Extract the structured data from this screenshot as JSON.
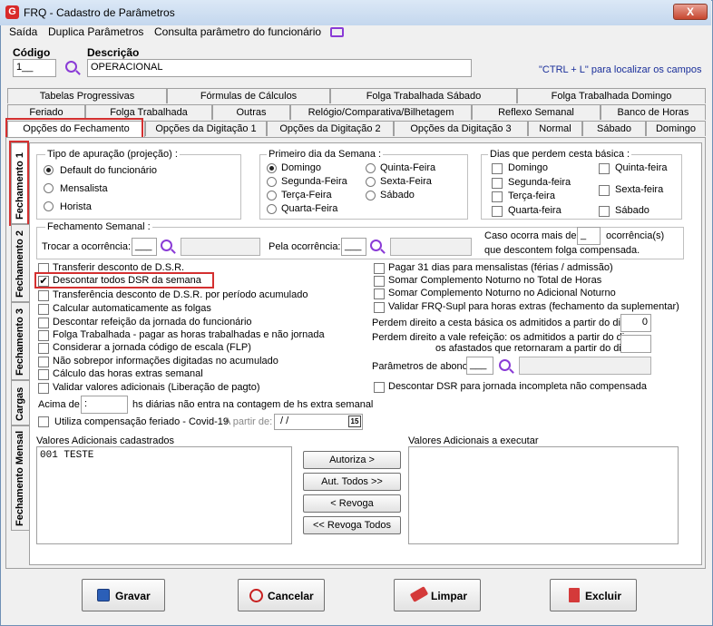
{
  "window": {
    "title": "FRQ - Cadastro de Parâmetros",
    "close": "X"
  },
  "menu": [
    "Saída",
    "Duplica Parâmetros",
    "Consulta parâmetro do funcionário"
  ],
  "header": {
    "codigo_label": "Código",
    "codigo_value": "1__",
    "descricao_label": "Descrição",
    "descricao_value": "OPERACIONAL",
    "hint": "\"CTRL + L\" para localizar os campos"
  },
  "tabs_row1": [
    "Tabelas Progressivas",
    "Fórmulas de Cálculos",
    "Folga Trabalhada Sábado",
    "Folga Trabalhada Domingo"
  ],
  "tabs_row2": [
    "Feriado",
    "Folga Trabalhada",
    "Outras",
    "Relógio/Comparativa/Bilhetagem",
    "Reflexo Semanal",
    "Banco de Horas"
  ],
  "tabs_row3": [
    "Opções do Fechamento",
    "Opções da Digitação 1",
    "Opções da Digitação 2",
    "Opções da Digitação 3",
    "Normal",
    "Sábado",
    "Domingo"
  ],
  "vtabs": [
    "Fechamento 1",
    "Fechamento 2",
    "Fechamento 3",
    "Cargas",
    "Fechamento Mensal"
  ],
  "tipo": {
    "title": "Tipo de apuração (projeção) :",
    "options": [
      "Default do funcionário",
      "Mensalista",
      "Horista"
    ]
  },
  "primeiro": {
    "title": "Primeiro dia da Semana :",
    "col1": [
      "Domingo",
      "Segunda-Feira",
      "Terça-Feira",
      "Quarta-Feira"
    ],
    "col2": [
      "Quinta-Feira",
      "Sexta-Feira",
      "Sábado"
    ]
  },
  "dias": {
    "title": "Dias que perdem cesta básica :",
    "col1": [
      "Domingo",
      "Segunda-feira",
      "Terça-feira",
      "Quarta-feira"
    ],
    "col2": [
      "Quinta-feira",
      "Sexta-feira",
      "Sábado"
    ]
  },
  "fech_sem": {
    "title": "Fechamento Semanal :",
    "trocar": "Trocar a ocorrência:",
    "trocar_val": "___",
    "pela": "Pela ocorrência:",
    "pela_val": "___",
    "caso1": "Caso ocorra mais de",
    "caso_val": "_",
    "caso2": "ocorrência(s)",
    "caso3": "que descontem folga compensada."
  },
  "left_checks": [
    "Transferir desconto de D.S.R.",
    "Descontar todos DSR da semana",
    "Transferência desconto de D.S.R. por período acumulado",
    "Calcular automaticamente as folgas",
    "Descontar refeição da jornada do funcionário",
    "Folga Trabalhada - pagar as horas trabalhadas e não jornada",
    "Considerar a jornada código de escala (FLP)",
    "Não sobrepor informações digitadas no acumulado",
    "Cálculo das horas extras semanal",
    "Validar valores adicionais (Liberação de pagto)"
  ],
  "right_checks": [
    "Pagar 31 dias para mensalistas (férias / admissão)",
    "Somar Complemento Noturno no Total de Horas",
    "Somar Complemento Noturno no Adicional Noturno",
    "Validar FRQ-Supl para horas extras (fechamento da suplementar)"
  ],
  "acima": {
    "label1": "Acima de",
    "value": " :",
    "label2": "hs diárias não entra na contagem de hs extra semanal"
  },
  "covid": {
    "label": "Utiliza compensação feriado - Covid-19",
    "apartir": "A partir de:",
    "date": " /  /",
    "cal": "15"
  },
  "cesta": {
    "label": "Perdem direito a cesta básica os admitidos a partir do dia",
    "value": "0"
  },
  "vale": {
    "label1": "Perdem direito a vale refeição: os admitidos a partir do dia",
    "label2": "os afastados que retornaram a partir do dia"
  },
  "abono": {
    "label": "Parâmetros de abono",
    "value": "___"
  },
  "dsr_incompleta": "Descontar DSR para jornada incompleta não compensada",
  "valores": {
    "cad_title": "Valores Adicionais cadastrados",
    "cad_items": [
      "001 TESTE"
    ],
    "exec_title": "Valores Adicionais a executar",
    "btns": [
      "Autoriza >",
      "Aut. Todos >>",
      "< Revoga",
      "<< Revoga Todos"
    ]
  },
  "footer": {
    "gravar": "Gravar",
    "cancelar": "Cancelar",
    "limpar": "Limpar",
    "excluir": "Excluir"
  }
}
